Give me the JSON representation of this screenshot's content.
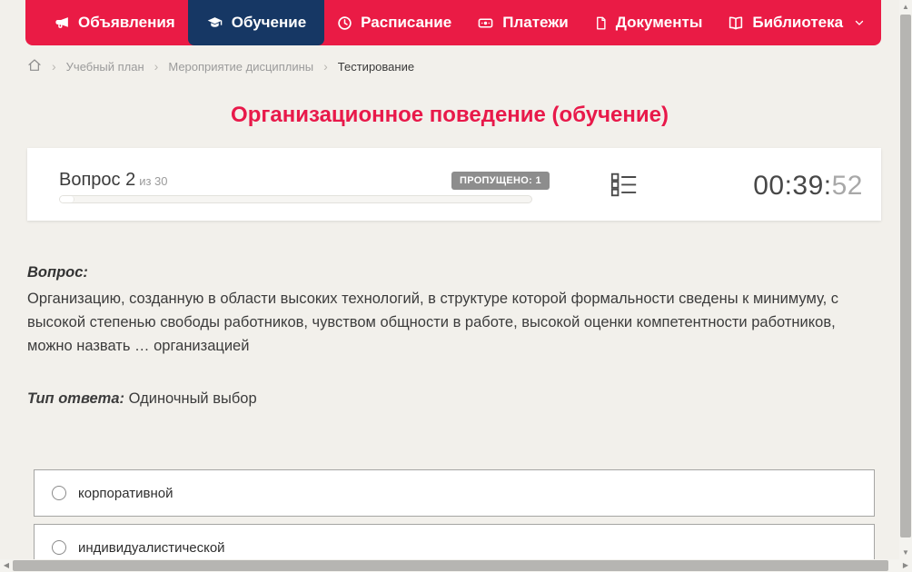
{
  "nav": {
    "items": [
      {
        "label": "Объявления",
        "icon": "megaphone-icon",
        "active": false
      },
      {
        "label": "Обучение",
        "icon": "graduation-cap-icon",
        "active": true
      },
      {
        "label": "Расписание",
        "icon": "clock-icon",
        "active": false
      },
      {
        "label": "Платежи",
        "icon": "banknote-icon",
        "active": false
      },
      {
        "label": "Документы",
        "icon": "document-icon",
        "active": false
      },
      {
        "label": "Библиотека",
        "icon": "open-book-icon",
        "active": false,
        "has_dropdown": true
      }
    ],
    "colors": {
      "bar": "#ea1b45",
      "active_item": "#163764"
    }
  },
  "breadcrumb": {
    "items": [
      {
        "label": "Учебный план"
      },
      {
        "label": "Мероприятие дисциплины"
      },
      {
        "label": "Тестирование"
      }
    ]
  },
  "page": {
    "title": "Организационное поведение (обучение)",
    "title_color": "#e8194a"
  },
  "question_panel": {
    "question_label": "Вопрос 2",
    "question_of": "из 30",
    "skipped_badge": "ПРОПУЩЕНО: 1",
    "progress_percent": 3,
    "timer": {
      "main": "00:39:",
      "seconds": "52"
    }
  },
  "question": {
    "prompt_label": "Вопрос:",
    "text": "Организацию, созданную в области высоких технологий, в структуре которой формальности сведены к минимуму, с высокой степенью свободы работников, чувством общности в работе, высокой оценки компетентности работников, можно назвать … организацией",
    "answer_type_label": "Тип ответа:",
    "answer_type_value": "Одиночный выбор"
  },
  "options": [
    {
      "label": "корпоративной",
      "selected": false
    },
    {
      "label": "индивидуалистической",
      "selected": false
    }
  ]
}
